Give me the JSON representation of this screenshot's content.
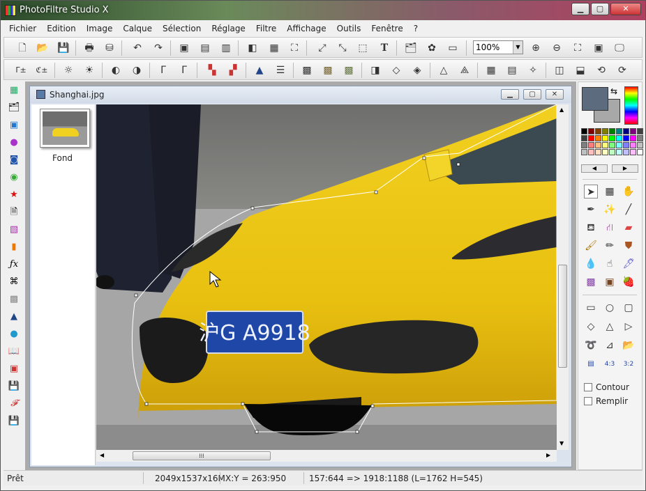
{
  "app": {
    "title": "PhotoFiltre Studio X"
  },
  "window_controls": {
    "minimize": "▁",
    "maximize": "▢",
    "close": "✕"
  },
  "menu": [
    "Fichier",
    "Edition",
    "Image",
    "Calque",
    "Sélection",
    "Réglage",
    "Filtre",
    "Affichage",
    "Outils",
    "Fenêtre",
    "?"
  ],
  "toolbar1": {
    "zoom_value": "100%",
    "icons": [
      "new-icon",
      "open-icon",
      "save-icon",
      "print-icon",
      "scan-icon",
      "undo-icon",
      "redo-icon",
      "paste-icon",
      "paste-new-icon",
      "export-icon",
      "mask-icon",
      "rgb-icon",
      "crop-icon",
      "image-size-icon",
      "canvas-size-icon",
      "selection-icon",
      "text-icon",
      "explorer-icon",
      "plugins-icon",
      "browser-icon",
      "zoom-in-icon",
      "zoom-out-icon",
      "fit-icon",
      "actual-size-icon",
      "fullscreen-icon"
    ]
  },
  "toolbar2": {
    "icons": [
      "gamma-plus-auto-icon",
      "gamma-minus-auto-icon",
      "brightness-minus-icon",
      "brightness-plus-icon",
      "contrast-minus-icon",
      "contrast-plus-icon",
      "gamma-minus-icon",
      "gamma-plus-icon",
      "saturation-minus-icon",
      "saturation-plus-icon",
      "histogram-icon",
      "levels-icon",
      "dither-icon",
      "noise-icon",
      "texture-icon",
      "softness-icon",
      "blur-icon",
      "sharpen-icon",
      "emboss-icon",
      "edge-icon",
      "gradient-icon",
      "fade-icon",
      "transparent-icon",
      "mirror-icon",
      "flip-icon",
      "rotate-icon",
      "rotate-right-icon"
    ]
  },
  "left_tools": [
    "calculator-icon",
    "explorer-icon",
    "image-icon",
    "sphere-icon",
    "camera-icon",
    "globe-icon",
    "star-icon",
    "note-icon",
    "gradient-icon",
    "color-icon",
    "formula-icon",
    "cloverleaf-icon",
    "mosaic-icon",
    "histogram-icon",
    "sphere-blue-icon",
    "book-icon",
    "frame-icon",
    "save-2000-icon",
    "font-icon",
    "save-html-icon"
  ],
  "document": {
    "title": "Shanghai.jpg",
    "layer_name": "Fond",
    "plate_text": "沪G A9918"
  },
  "right_panel": {
    "fg_color": "#5c6b7e",
    "bg_color": "#a8a8a8",
    "palette": [
      "#000000",
      "#7f0000",
      "#7f3f00",
      "#7f7f00",
      "#007f00",
      "#007f7f",
      "#00007f",
      "#7f007f",
      "#404040",
      "#3f3f3f",
      "#ff0000",
      "#ff7f00",
      "#ffff00",
      "#00ff00",
      "#00ffff",
      "#0000ff",
      "#ff00ff",
      "#808080",
      "#7f7f7f",
      "#ff7f7f",
      "#ffbf7f",
      "#ffff7f",
      "#7fff7f",
      "#7fffff",
      "#7f7fff",
      "#ff7fff",
      "#c0c0c0",
      "#bfbfbf",
      "#ffbfbf",
      "#ffdfbf",
      "#ffffbf",
      "#bfffbf",
      "#bfffff",
      "#bfbfff",
      "#ffbfff",
      "#ffffff"
    ],
    "tools": [
      "pointer-icon",
      "selection-icon",
      "hand-icon",
      "eyedropper-icon",
      "magic-wand-icon",
      "line-icon",
      "fill-icon",
      "spray-icon",
      "eraser-icon",
      "brush-icon",
      "pencil-icon",
      "stamp-icon",
      "blur-drop-icon",
      "smudge-icon",
      "pen-icon",
      "pattern-icon",
      "portrait-icon",
      "strawberry-icon"
    ],
    "shapes": [
      "rectangle-icon",
      "ellipse-icon",
      "rounded-rect-icon",
      "diamond-icon",
      "triangle-icon",
      "arrow-right-icon",
      "lasso-icon",
      "polygon-icon",
      "open-folder-icon",
      "selection-all-icon",
      "ratio-43-icon",
      "ratio-32-icon"
    ],
    "ratio_43": "4:3",
    "ratio_32": "3:2",
    "contour_label": "Contour",
    "remplir_label": "Remplir"
  },
  "status": {
    "ready": "Prêt",
    "size": "2049x1537x16M",
    "coords": "X:Y = 263:950",
    "selection": "157:644 => 1918:1188 (L=1762  H=545)"
  }
}
